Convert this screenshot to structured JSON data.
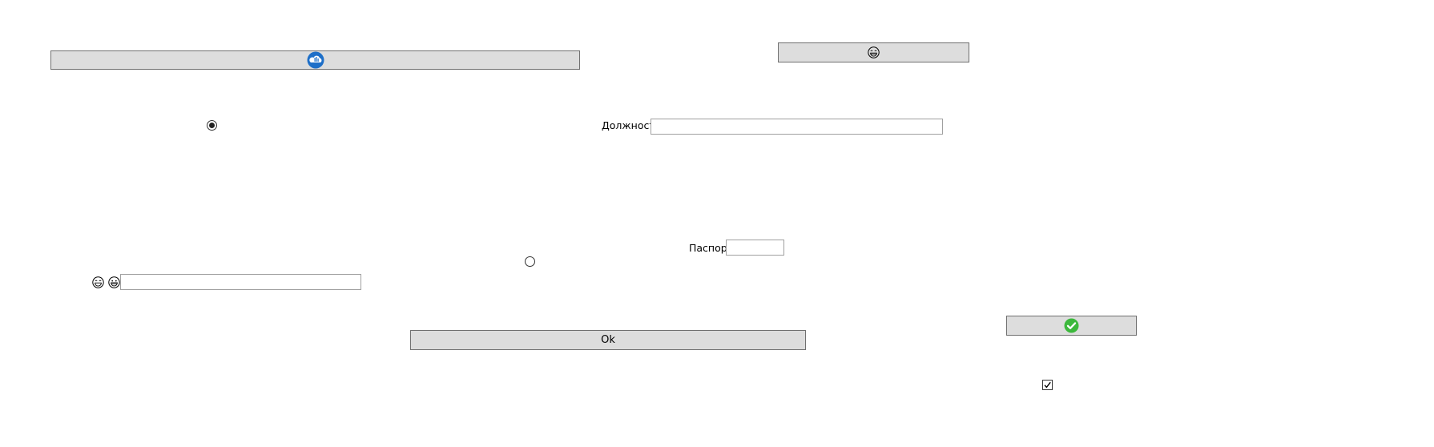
{
  "buttons": {
    "top_left_icon": "cloud-upload-icon",
    "top_center_icon": "laughing-face-icon",
    "ok_label": "Ok",
    "right_icon": "check-circle-icon"
  },
  "fields": {
    "position_label": "Должность",
    "position_value": "",
    "passport_label": "Паспорт",
    "passport_value": "",
    "emoji_field_value": ""
  },
  "controls": {
    "radio_1_checked": true,
    "radio_2_checked": false,
    "checkbox_checked": true
  },
  "colors": {
    "button_bg": "#dddddd",
    "button_border": "#707070",
    "cloud_icon_blue": "#1e6fc8",
    "check_icon_green": "#3cb83c"
  }
}
